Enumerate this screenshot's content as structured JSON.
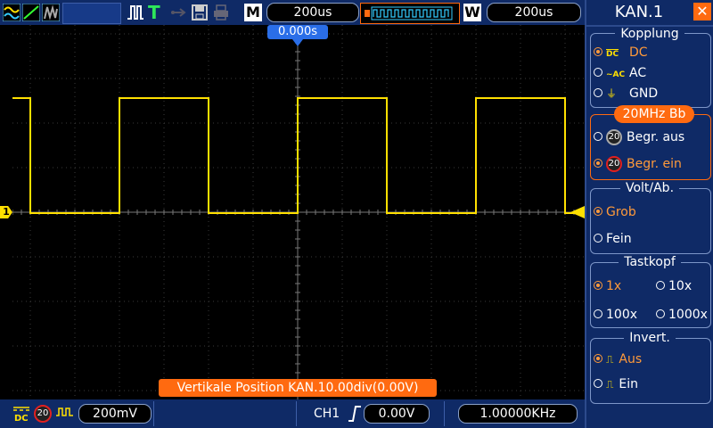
{
  "topbar": {
    "mode_letter": "M",
    "timebase": "200us",
    "window_letter": "W",
    "window_timebase": "200us",
    "trigger_pos": "0.000s"
  },
  "screen": {
    "channel_marker": "1",
    "status_message": "Vertikale  Position  KAN.10.00div(0.00V)"
  },
  "bottombar": {
    "coupling_icon": "dc-coupling-icon",
    "bw_badge": "20",
    "volts_div": "200mV",
    "trig_source": "CH1",
    "trig_level": "0.00V",
    "frequency": "1.00000KHz"
  },
  "panel": {
    "title": "KAN.1",
    "coupling": {
      "title": "Kopplung",
      "options": [
        "DC",
        "AC",
        "GND"
      ],
      "selected": "DC"
    },
    "bandwidth": {
      "title": "20MHz  Bb",
      "badge": "20",
      "options": [
        "Begr.  aus",
        "Begr.  ein"
      ],
      "selected": "Begr.  ein"
    },
    "voltsdiv": {
      "title": "Volt/Ab.",
      "options": [
        "Grob",
        "Fein"
      ],
      "selected": "Grob"
    },
    "probe": {
      "title": "Tastkopf",
      "options": [
        "1x",
        "10x",
        "100x",
        "1000x"
      ],
      "selected": "1x"
    },
    "invert": {
      "title": "Invert.",
      "options": [
        "Aus",
        "Ein"
      ],
      "selected": "Aus"
    }
  },
  "colors": {
    "trace": "#ffe000",
    "accent": "#ff6a10",
    "bar_bg": "#0f2a66",
    "selected": "#ff9a3a"
  }
}
